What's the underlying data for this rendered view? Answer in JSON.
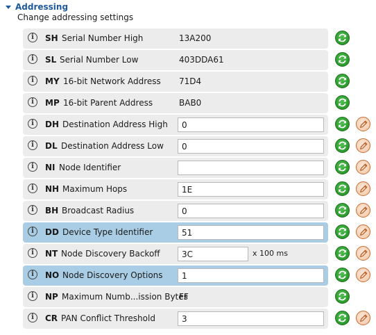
{
  "section": {
    "title": "Addressing",
    "description": "Change addressing settings"
  },
  "icons": {
    "info": "info-icon",
    "read": "refresh-icon",
    "write": "pencil-icon"
  },
  "colors": {
    "header": "#1c5a9c",
    "row_bg": "#ececec",
    "row_selected": "#a9cde4",
    "read_button": "#2a9a2a",
    "write_button": "#c96a2e"
  },
  "rows": [
    {
      "code": "SH",
      "name": "Serial Number High",
      "value": "13A200",
      "type": "text",
      "selected": false,
      "writable": false
    },
    {
      "code": "SL",
      "name": "Serial Number Low",
      "value": "403DDA61",
      "type": "text",
      "selected": false,
      "writable": false
    },
    {
      "code": "MY",
      "name": "16-bit Network Address",
      "value": "71D4",
      "type": "text",
      "selected": false,
      "writable": false
    },
    {
      "code": "MP",
      "name": "16-bit Parent Address",
      "value": "BAB0",
      "type": "text",
      "selected": false,
      "writable": false
    },
    {
      "code": "DH",
      "name": "Destination Address High",
      "value": "0",
      "type": "input",
      "selected": false,
      "writable": true
    },
    {
      "code": "DL",
      "name": "Destination Address Low",
      "value": "0",
      "type": "input",
      "selected": false,
      "writable": true
    },
    {
      "code": "NI",
      "name": "Node Identifier",
      "value": "",
      "type": "input",
      "selected": false,
      "writable": true
    },
    {
      "code": "NH",
      "name": "Maximum Hops",
      "value": "1E",
      "type": "input",
      "selected": false,
      "writable": true
    },
    {
      "code": "BH",
      "name": "Broadcast Radius",
      "value": "0",
      "type": "input",
      "selected": false,
      "writable": true
    },
    {
      "code": "DD",
      "name": "Device Type Identifier",
      "value": "51",
      "type": "input",
      "selected": true,
      "writable": true
    },
    {
      "code": "NT",
      "name": "Node Discovery Backoff",
      "value": "3C",
      "type": "input-short",
      "unit": "x 100 ms",
      "selected": false,
      "writable": true
    },
    {
      "code": "NO",
      "name": "Node Discovery Options",
      "value": "1",
      "type": "input",
      "selected": true,
      "writable": true
    },
    {
      "code": "NP",
      "name": "Maximum Numb...ission Bytes",
      "value": "FF",
      "type": "text",
      "selected": false,
      "writable": false
    },
    {
      "code": "CR",
      "name": "PAN Conflict Threshold",
      "value": "3",
      "type": "input",
      "selected": false,
      "writable": true
    }
  ]
}
